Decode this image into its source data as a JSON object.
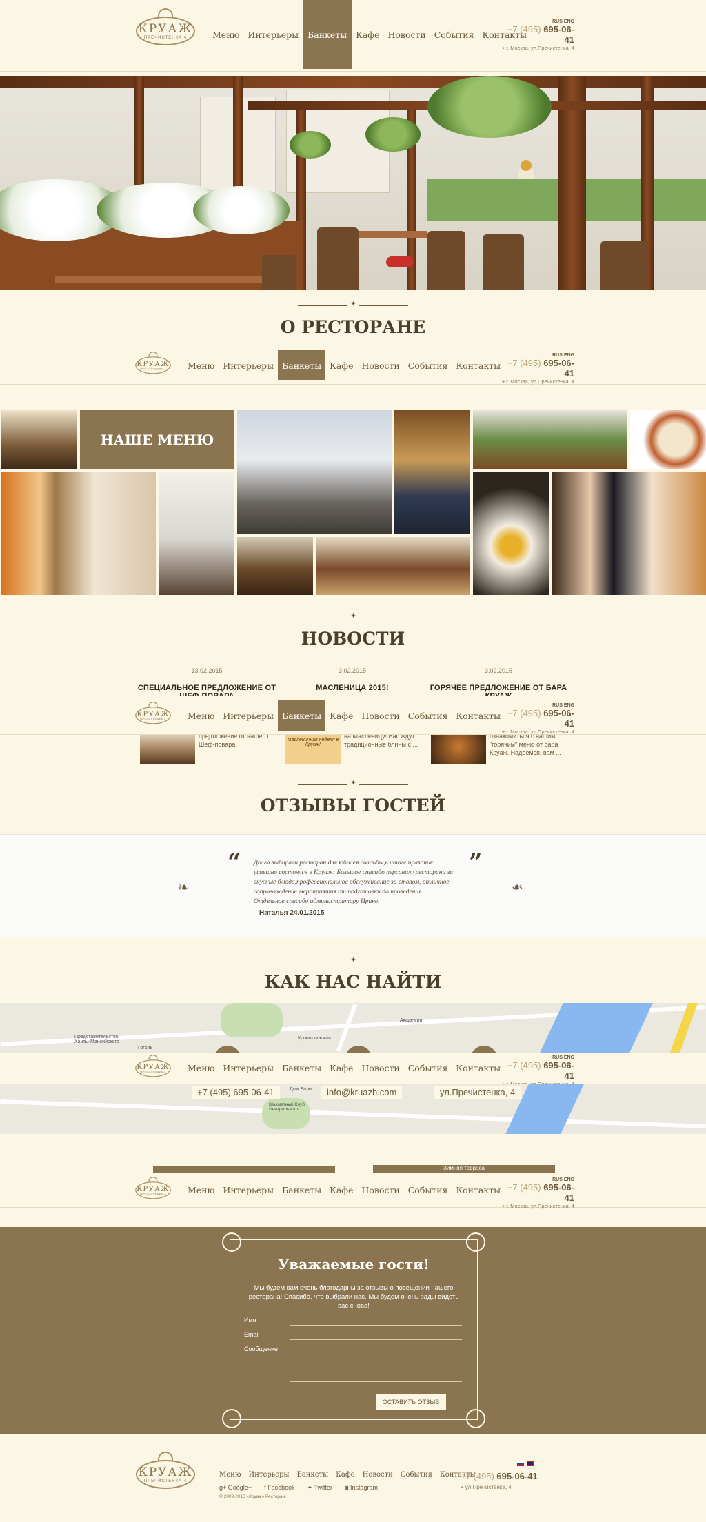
{
  "nav": {
    "logo_text": "КРУАЖ",
    "logo_sub": "ПРЕЧИСТЕНКА 4",
    "items": [
      "Меню",
      "Интерьеры",
      "Банкеты",
      "Кафе",
      "Новости",
      "События",
      "Контакты"
    ],
    "active": "Банкеты",
    "lang": "RUS ENG",
    "phone_prefix": "+7 (495)",
    "phone_number": "695-06-41",
    "address": "г. Москва, ул.Пречистенка, 4"
  },
  "about": {
    "title": "О РЕСТОРАНЕ"
  },
  "gallery": {
    "menu_label": "НАШЕ МЕНЮ"
  },
  "news": {
    "title": "НОВОСТИ",
    "items": [
      {
        "date": "13.02.2015",
        "title": "СПЕЦИАЛЬНОЕ ПРЕДЛОЖЕНИЕ ОТ ШЕФ-ПОВАРА",
        "text": "предложение от нашего Шеф-повара."
      },
      {
        "date": "3.02.2015",
        "title": "МАСЛЕНИЦА 2015!",
        "text": "на Масленицу! Вас ждут традиционные блины с ...",
        "thumb_text": "Масленичная неделя в Круаж!"
      },
      {
        "date": "3.02.2015",
        "title": "ГОРЯЧЕЕ ПРЕДЛОЖЕНИЕ ОТ БАРА КРУАЖ",
        "text": "ознакомиться с нашим \"горячим\" меню от бара Круаж. Надеемся, вам ..."
      }
    ]
  },
  "reviews": {
    "title": "ОТЗЫВЫ ГОСТЕЙ",
    "text": "Долго выбирали ресторан для юбилея свадьбы,в итоге праздник успешно состоялся в Круаж. Большое спасибо персоналу ресторана за вкусные блюда,профессиональное обслуживание за столом, отличное сопровождение мероприятия от подготовки до проведения. Отдельное спасибо администратору Ирине.",
    "author": "Наталья 24.01.2015"
  },
  "find_us": {
    "title": "КАК НАС НАЙТИ",
    "phone": "+7 (495) 695-06-41",
    "email": "info@kruazh.com",
    "address": "ул.Пречистенка, 4",
    "map_labels": [
      "Академия",
      "Представительство Ханты-Мансийского",
      "Гоголь",
      "Кропоткинская",
      "Дом Бали",
      "Шахматный Клуб Центрального"
    ],
    "peek_label": "Зимняя терраса"
  },
  "feedback": {
    "title": "Уважаемые гости!",
    "subtitle": "Мы будем вам очень благодарны за отзывы о посещении нашего ресторана! Спасибо, что выбрали нас. Мы будем очень рады видеть вас снова!",
    "name_label": "Имя",
    "email_label": "Email",
    "message_label": "Сообщение",
    "submit": "ОСТАВИТЬ ОТЗЫВ"
  },
  "footer": {
    "menu": [
      "Меню",
      "Интерьеры",
      "Банкеты",
      "Кафе",
      "Новости",
      "События",
      "Контакты"
    ],
    "social": [
      "Google+",
      "Facebook",
      "Twitter",
      "Instagram"
    ],
    "copyright": "© 2009-2015 «Круаж» Ресторан.",
    "phone_prefix": "+7 (495)",
    "phone_number": "695-06-41",
    "address": "ул.Пречистенка, 4"
  },
  "colors": {
    "accent": "#8b7450",
    "background": "#fcf6e4",
    "text": "#4a3e2c"
  }
}
